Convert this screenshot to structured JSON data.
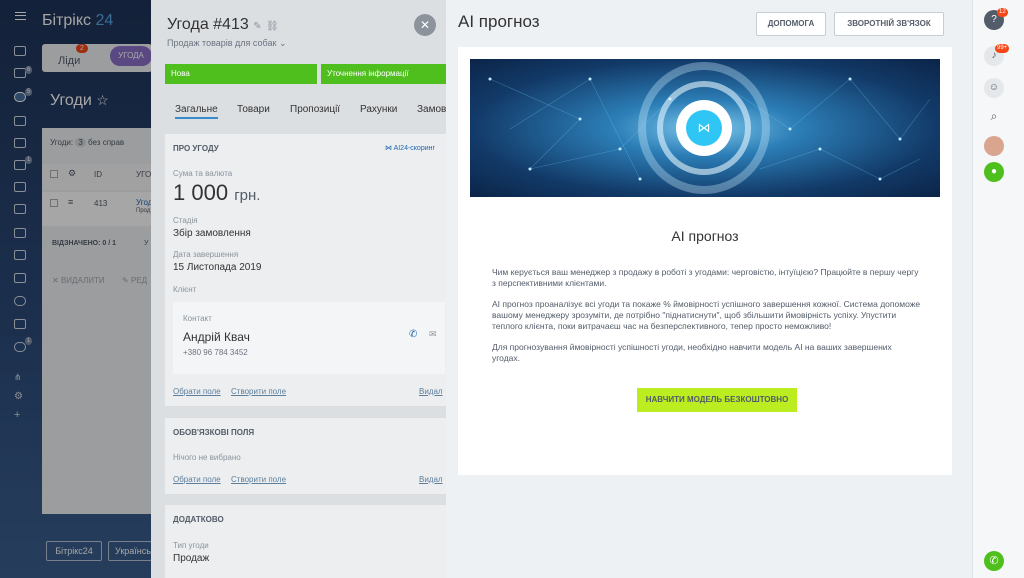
{
  "background": {
    "logo_name": "Бітрікс",
    "logo_num": "24",
    "leads_label": "Ліди",
    "leads_count": "2",
    "deal_pill": "УГОДА",
    "title": "Угоди",
    "nav_counts": [
      "6",
      "5",
      "1",
      "1"
    ],
    "list": {
      "filter_text": "Угоди:",
      "filter_count": "3",
      "filter_suffix": "без справ",
      "col_id": "ID",
      "col_name": "УГО",
      "row_id": "413",
      "row_name": "Угод",
      "row_sub": "Прод",
      "selected": "ВІДЗНАЧЕНО: 0 / 1",
      "selected_extra": "У",
      "delete": "ВИДАЛИТИ",
      "edit": "РЕД"
    },
    "footer_logo": "Бітрікс24",
    "footer_lang": "Українськ"
  },
  "deal": {
    "title": "Угода #413",
    "subtitle": "Продаж товарів для собак",
    "stages": [
      "Нова",
      "Уточнення інформації"
    ],
    "tabs": [
      "Загальне",
      "Товари",
      "Пропозиції",
      "Рахунки",
      "Замов"
    ],
    "about": {
      "head": "ПРО УГОДУ",
      "scoring": "AI24-скоринг",
      "amount_label": "Сума та валюта",
      "amount": "1 000",
      "currency": "грн.",
      "stage_label": "Стадія",
      "stage_value": "Збір замовлення",
      "date_label": "Дата завершення",
      "date_value": "15 Листопада 2019",
      "client_label": "Клієнт",
      "contact_label": "Контакт",
      "contact_name": "Андрій Квач",
      "contact_phone": "+380 96 784 3452",
      "choose_field": "Обрати поле",
      "create_field": "Створити поле",
      "delete": "Видал"
    },
    "required": {
      "head": "ОБОВ'ЯЗКОВІ ПОЛЯ",
      "nothing": "Нічого не вибрано",
      "choose_field": "Обрати поле",
      "create_field": "Створити поле",
      "delete": "Видал"
    },
    "extra": {
      "head": "ДОДАТКОВО",
      "type_label": "Тип угоди",
      "type_value": "Продаж"
    }
  },
  "ai": {
    "header_title": "AI прогноз",
    "help_btn": "Допомога",
    "feedback_btn": "Зворотній зв'язок",
    "card_title": "AI прогноз",
    "para1": "Чим керується ваш менеджер з продажу в роботі з угодами: черговістю, інтуїцією? Працюйте в першу чергу з перспективними клієнтами.",
    "para2": "AI прогноз проаналізує всі угоди та покаже % ймовірності успішного завершення кожної. Система допоможе вашому менеджеру зрозуміти, де потрібно \"піднатиснути\", щоб збільшити ймовірність успіху. Упустити теплого клієнта, поки витрачаєш час на безперспективного, тепер просто неможливо!",
    "para3": "Для прогнозування ймовірності успішності угоди, необхідно навчити модель AI на ваших завершених угодах.",
    "train_btn": "Навчити модель безкоштовно"
  },
  "right_bar": {
    "help_count": "12",
    "notify_count": "99+"
  },
  "colors": {
    "stage_green": "#4fbf1d",
    "accent_lime": "#bbed21",
    "badge_red": "#f54819"
  }
}
